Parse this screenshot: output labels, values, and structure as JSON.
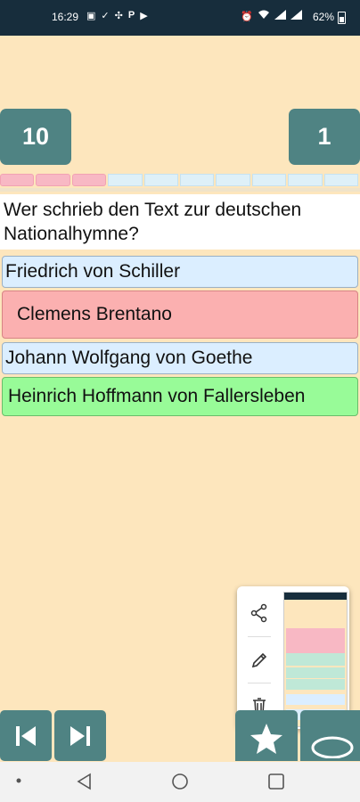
{
  "status_bar": {
    "time": "16:29",
    "battery": "62%",
    "left_icons": [
      "gallery-icon",
      "check-icon",
      "settings-icon",
      "parking-icon",
      "play-store-icon"
    ],
    "right_icons": [
      "alarm-icon",
      "wifi-icon",
      "signal-icon",
      "signal-icon",
      "battery-icon"
    ]
  },
  "scores": {
    "left": "10",
    "right": "1"
  },
  "progress": {
    "total_segments": 10,
    "completed_segments": 3
  },
  "question": "Wer schrieb den Text zur deutschen Nationalhymne?",
  "answers": [
    {
      "text": "Friedrich von Schiller",
      "state": "neutral"
    },
    {
      "text": "Clemens Brentano",
      "state": "wrong"
    },
    {
      "text": "Johann Wolfgang von Goethe",
      "state": "neutral"
    },
    {
      "text": "Heinrich Hoffmann von Fallersleben",
      "state": "correct"
    }
  ],
  "screenshot_preview": {
    "actions": [
      "share-icon",
      "edit-icon",
      "delete-icon"
    ]
  },
  "controls": {
    "icons": [
      "skip-previous-icon",
      "skip-next-icon",
      "star-icon",
      "oval-icon"
    ]
  },
  "nav_bar": {
    "icons": [
      "recents-dot-icon",
      "back-icon",
      "home-icon",
      "overview-icon"
    ]
  },
  "colors": {
    "background": "#fde6bd",
    "accent": "#4f8383",
    "neutral_answer": "#dbeeff",
    "wrong_answer": "#fbb0b0",
    "correct_answer": "#98fb98",
    "status_bar": "#172d3c"
  }
}
